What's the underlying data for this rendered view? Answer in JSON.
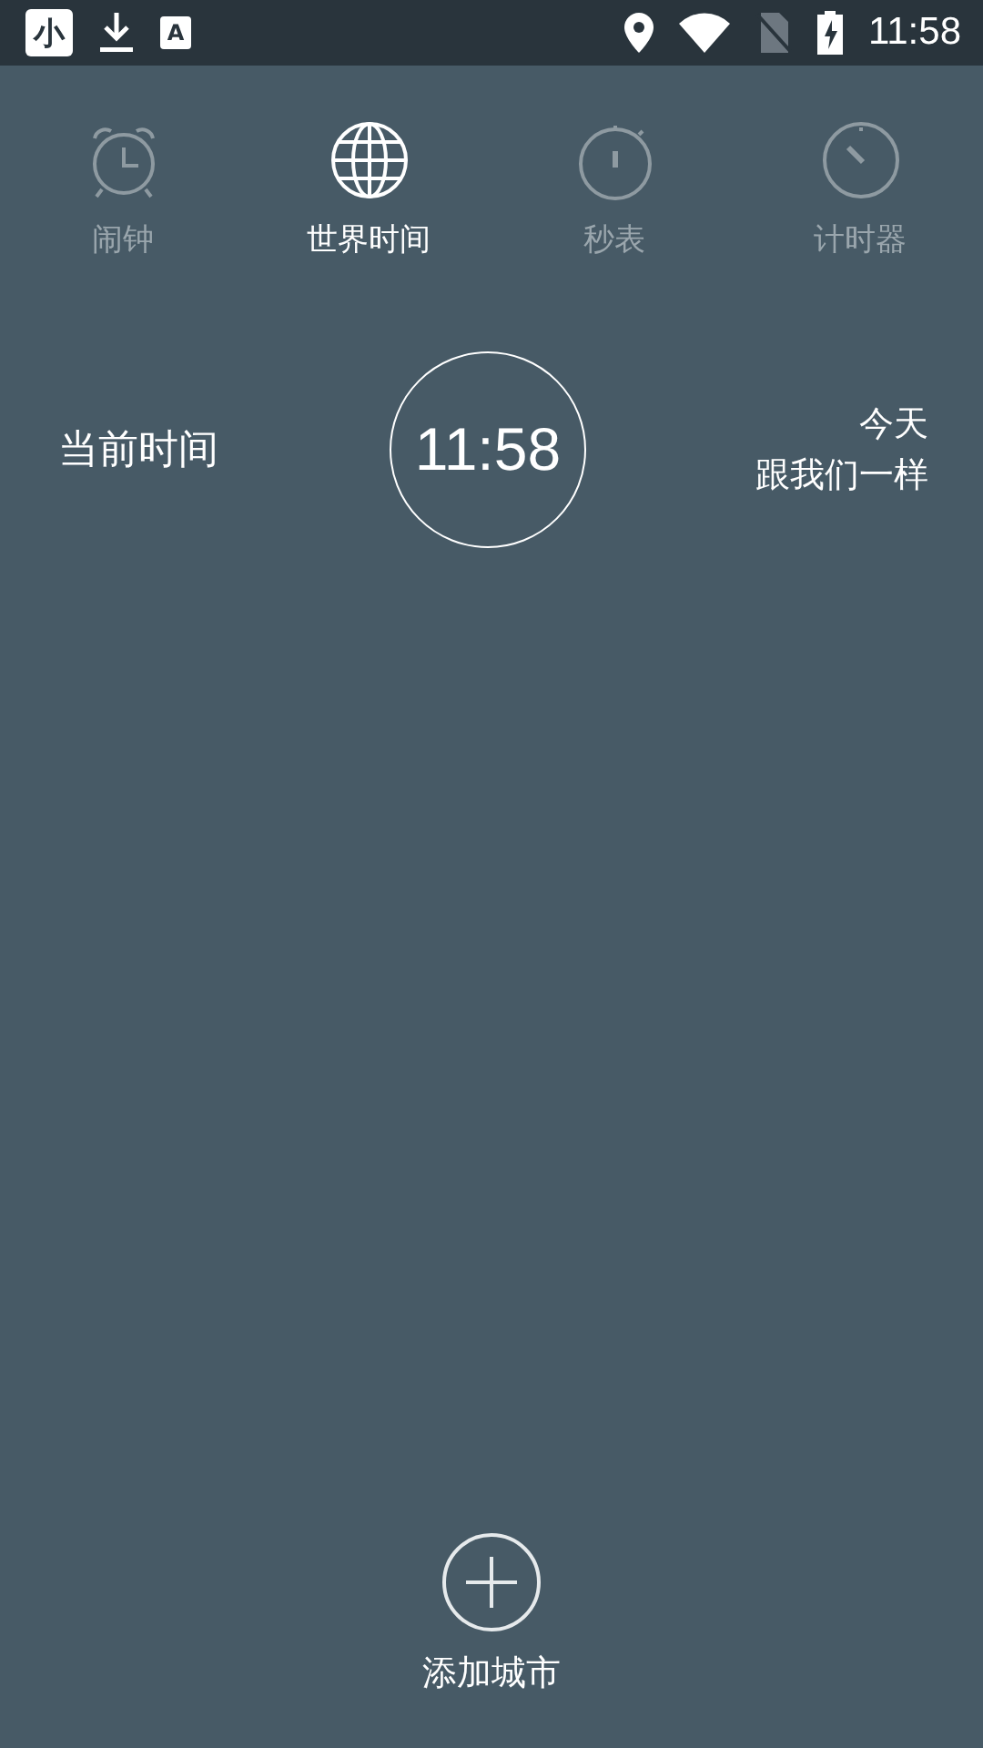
{
  "status_bar": {
    "app_badge": "小",
    "text_badge": "A",
    "time": "11:58"
  },
  "tabs": [
    {
      "kind": "alarm",
      "label": "闹钟",
      "selected": false
    },
    {
      "kind": "globe",
      "label": "世界时间",
      "selected": true
    },
    {
      "kind": "stopwatch",
      "label": "秒表",
      "selected": false
    },
    {
      "kind": "timer",
      "label": "计时器",
      "selected": false
    }
  ],
  "local_clock": {
    "label": "当前时间",
    "time": "11:58",
    "day": "今天",
    "offset": "跟我们一样"
  },
  "add_button": {
    "label": "添加城市"
  }
}
